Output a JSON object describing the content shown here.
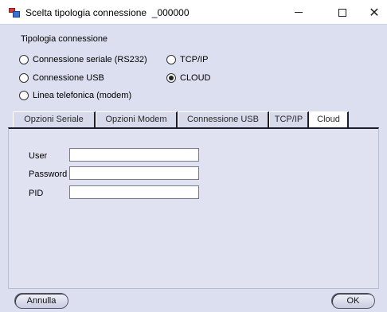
{
  "window": {
    "title": "Scelta tipologia connessione  _000000",
    "icon": "app-window-icon"
  },
  "connection_type": {
    "title": "Tipologia connessione",
    "options": [
      {
        "label": "Connessione seriale (RS232)",
        "selected": false
      },
      {
        "label": "TCP/IP",
        "selected": false
      },
      {
        "label": "Connessione USB",
        "selected": false
      },
      {
        "label": "CLOUD",
        "selected": true
      },
      {
        "label": "Linea telefonica (modem)",
        "selected": false
      }
    ]
  },
  "tabs": [
    {
      "label": "Opzioni Seriale",
      "active": false
    },
    {
      "label": "Opzioni Modem",
      "active": false
    },
    {
      "label": "Connessione USB",
      "active": false
    },
    {
      "label": "TCP/IP",
      "active": false
    },
    {
      "label": "Cloud",
      "active": true
    }
  ],
  "cloud_panel": {
    "user_label": "User",
    "user_value": "",
    "password_label": "Password",
    "password_value": "",
    "pid_label": "PID",
    "pid_value": ""
  },
  "buttons": {
    "cancel": "Annulla",
    "ok": "OK"
  }
}
